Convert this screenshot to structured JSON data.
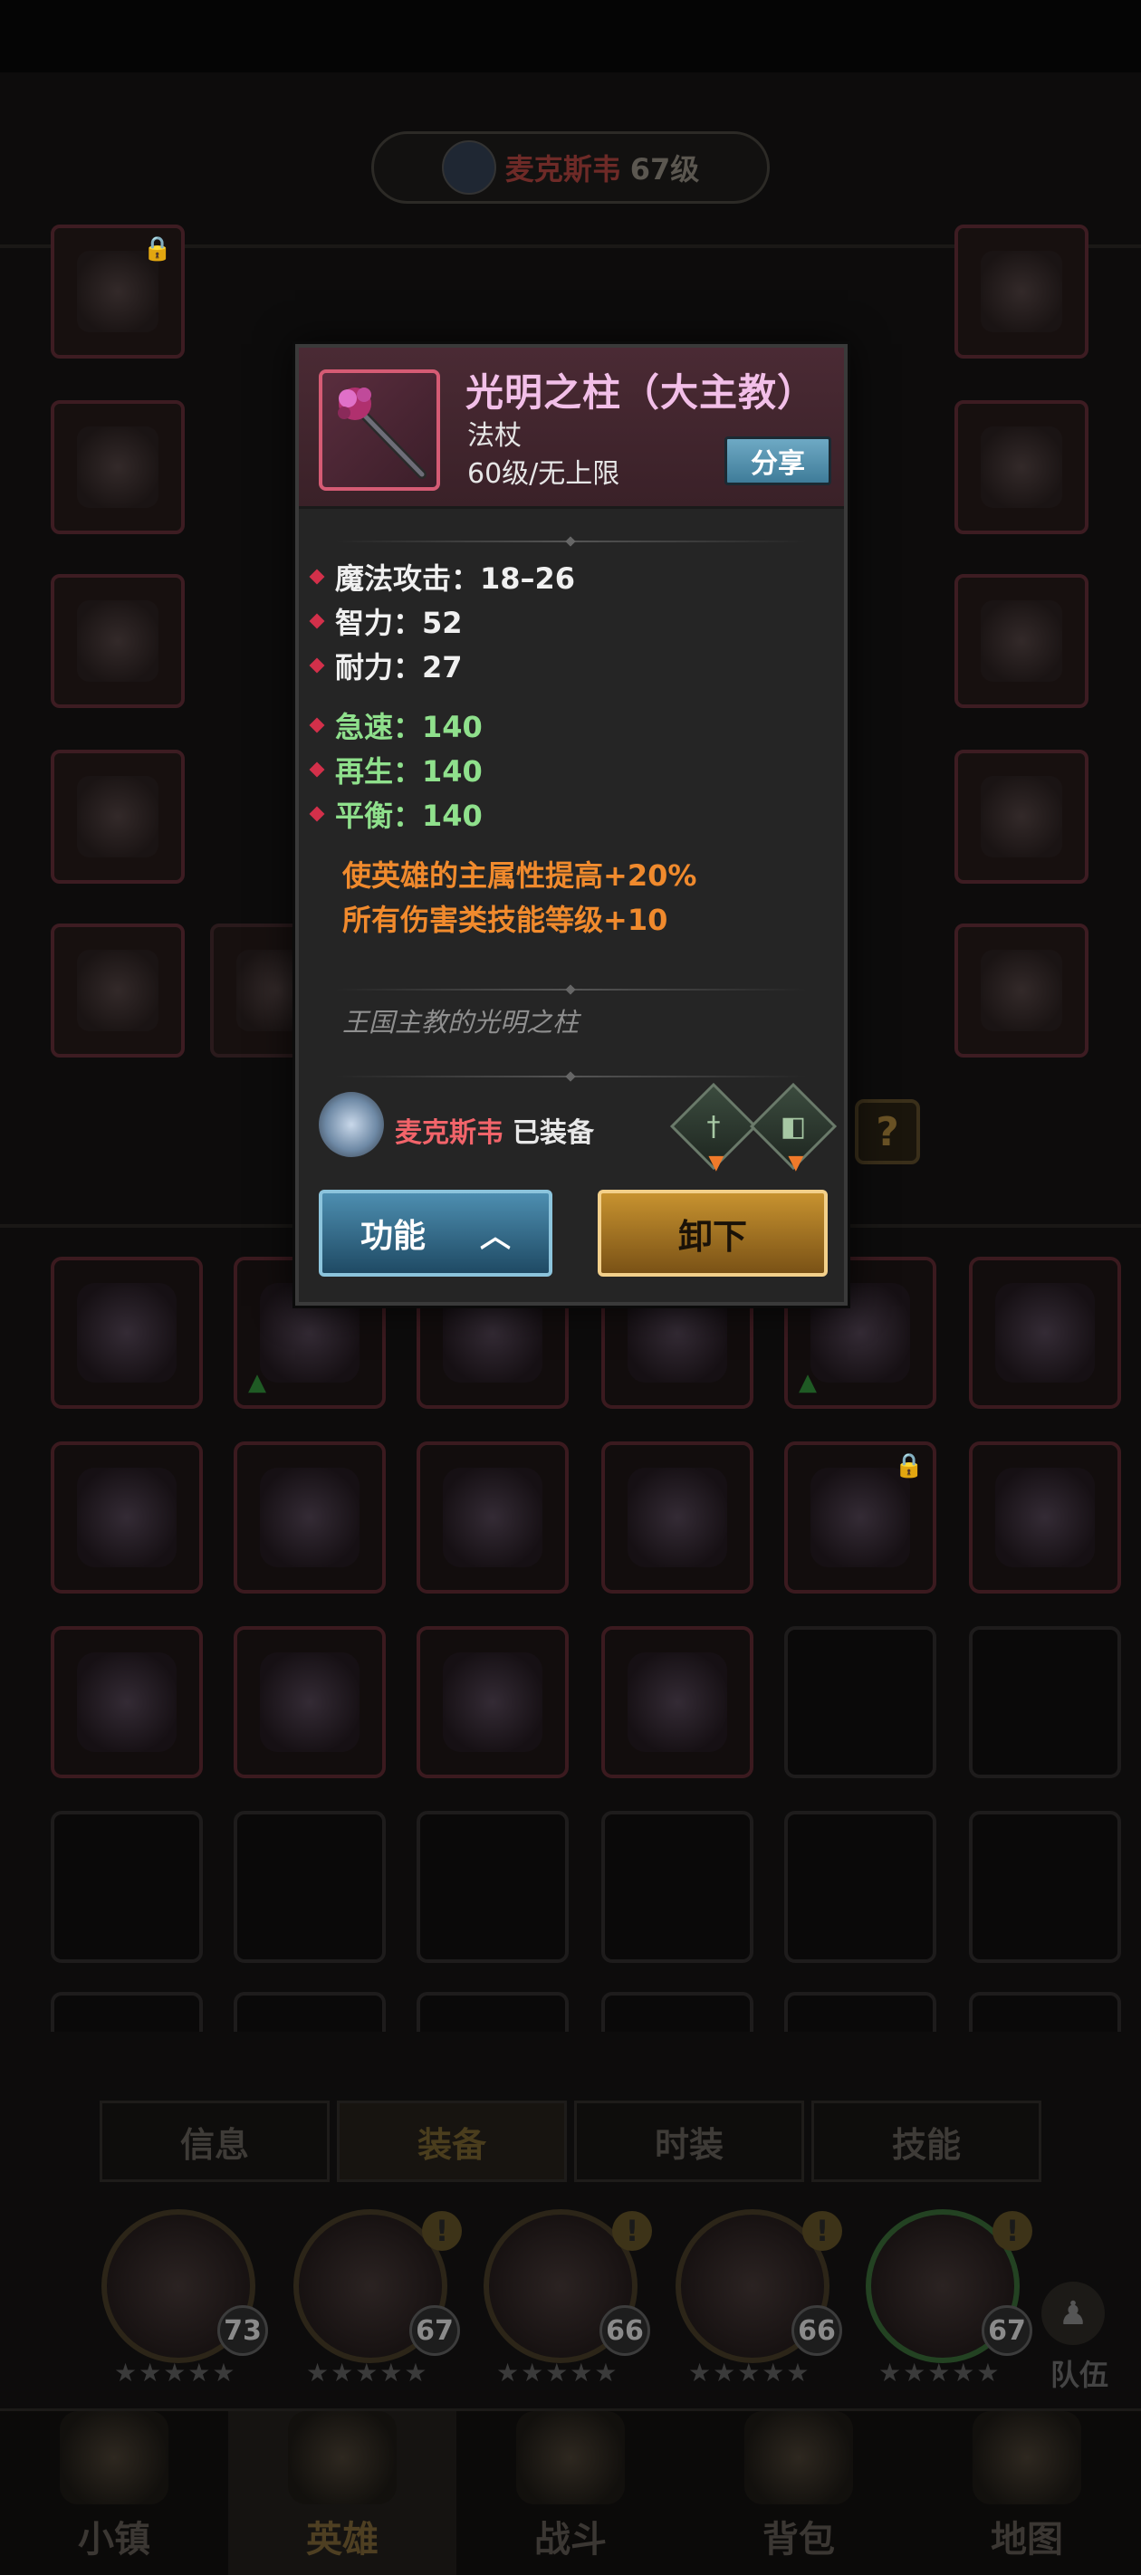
{
  "header": {
    "hero_name": "麦克斯韦",
    "hero_level": "67级"
  },
  "tabs": [
    "信息",
    "装备",
    "时装",
    "技能"
  ],
  "heroes": [
    {
      "level": "73"
    },
    {
      "level": "67"
    },
    {
      "level": "66"
    },
    {
      "level": "66"
    },
    {
      "level": "67"
    }
  ],
  "team_label": "队伍",
  "nav": [
    "小镇",
    "英雄",
    "战斗",
    "背包",
    "地图"
  ],
  "question_mark": "?",
  "item": {
    "name": "光明之柱（大主教）",
    "type": "法杖",
    "level_req": "60级/无上限",
    "share_label": "分享",
    "stats": [
      {
        "text": "魔法攻击：18–26",
        "color": "white"
      },
      {
        "text": "智力：52",
        "color": "white"
      },
      {
        "text": "耐力：27",
        "color": "white"
      },
      {
        "text": "急速：140",
        "color": "green"
      },
      {
        "text": "再生：140",
        "color": "green"
      },
      {
        "text": "平衡：140",
        "color": "green"
      }
    ],
    "effects": [
      "使英雄的主属性提高+20%",
      "所有伤害类技能等级+10"
    ],
    "flavor": "王国主教的光明之柱",
    "equipped_by": "麦克斯韦",
    "equipped_label": "已装备",
    "function_label": "功能",
    "unequip_label": "卸下"
  },
  "colors": {
    "title": "#f2bfe8",
    "green_stat": "#8fe08c",
    "effect": "#f08a2d",
    "hero_name": "#f2646a"
  }
}
